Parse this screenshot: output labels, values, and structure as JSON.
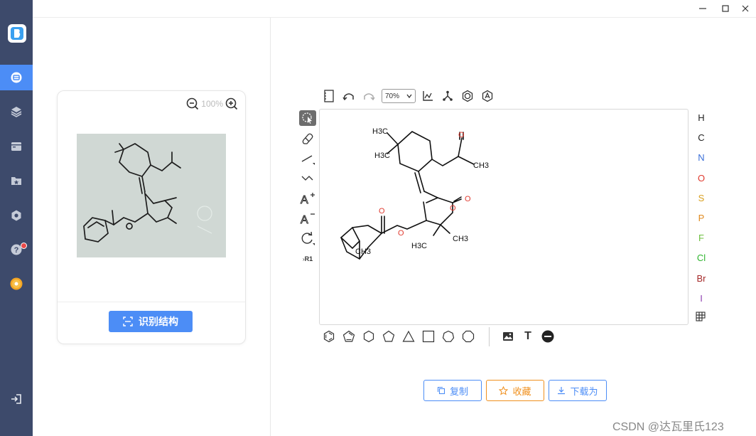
{
  "sidebar": {
    "logo_icon": "app-logo",
    "items": [
      {
        "name": "recognize",
        "icon": "scan-icon",
        "active": true
      },
      {
        "name": "layers",
        "icon": "layers-icon"
      },
      {
        "name": "calendar",
        "icon": "calendar-icon"
      },
      {
        "name": "folder",
        "icon": "folder-star-icon"
      },
      {
        "name": "settings",
        "icon": "hexagon-icon"
      },
      {
        "name": "help",
        "icon": "help-icon",
        "has_badge": true
      },
      {
        "name": "account",
        "icon": "coin-icon"
      }
    ],
    "logout_icon": "logout-icon",
    "colors": {
      "bg": "#3d4a6b",
      "active": "#4c8df6",
      "badge": "#e84a4a"
    }
  },
  "window": {
    "controls": [
      "minimize",
      "maximize",
      "close"
    ]
  },
  "preview": {
    "zoom_level": "100%",
    "recognize_button": "识别结构"
  },
  "editor": {
    "zoom_value": "70%",
    "left_tools": [
      "select",
      "eraser",
      "bond",
      "chain",
      "charge-plus",
      "charge-minus",
      "rotate",
      "R1"
    ],
    "r_group_label": "R1",
    "atoms": [
      {
        "symbol": "H",
        "color": "#222222"
      },
      {
        "symbol": "C",
        "color": "#222222"
      },
      {
        "symbol": "N",
        "color": "#3a6fd8"
      },
      {
        "symbol": "O",
        "color": "#e03a2f"
      },
      {
        "symbol": "S",
        "color": "#d9a020"
      },
      {
        "symbol": "P",
        "color": "#e08a1e"
      },
      {
        "symbol": "F",
        "color": "#6cbf3e"
      },
      {
        "symbol": "Cl",
        "color": "#2fb52f"
      },
      {
        "symbol": "Br",
        "color": "#a52a2a"
      },
      {
        "symbol": "I",
        "color": "#8e3fb0"
      }
    ],
    "periodic_table_icon": "periodic-table-icon",
    "text_tool_label": "T",
    "ring_tools": [
      "benzene",
      "cyclopentadiene",
      "cyclohexane",
      "cyclopentane",
      "cyclopropane",
      "cyclobutane",
      "cycloheptane",
      "cyclooctane"
    ],
    "molecule_labels": {
      "methyl_a": "H3C",
      "methyl_b": "H3C",
      "ketone_methyl": "CH3",
      "ring_methyl_1": "H3C",
      "ring_methyl_2": "CH3",
      "bridge_methyl": "CH3",
      "oxygen": "O"
    }
  },
  "actions": {
    "copy": "复制",
    "favorite": "收藏",
    "download": "下载为",
    "colors": {
      "copy": "#4c8df6",
      "favorite": "#f0901e",
      "download": "#4c8df6"
    }
  },
  "watermark": "CSDN @达瓦里氏123"
}
